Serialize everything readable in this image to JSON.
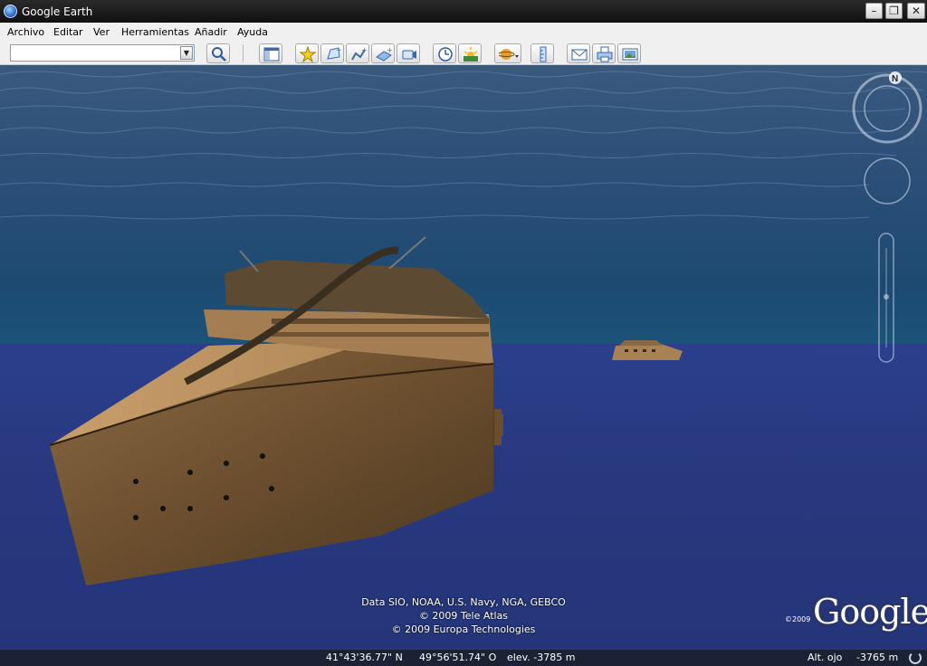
{
  "window": {
    "title": "Google Earth",
    "buttons": {
      "minimize": "–",
      "maximize": "❐",
      "close": "✕"
    }
  },
  "menu": [
    "Archivo",
    "Editar",
    "Ver",
    "Herramientas",
    "Añadir",
    "Ayuda"
  ],
  "search": {
    "value": "",
    "placeholder": ""
  },
  "toolbar": {
    "icons": [
      "search-icon",
      "sidebar-toggle-icon",
      "placemark-icon",
      "polygon-icon",
      "path-icon",
      "image-overlay-icon",
      "record-tour-icon",
      "historical-imagery-icon",
      "sunlight-icon",
      "planets-icon",
      "ruler-icon",
      "email-icon",
      "print-icon",
      "save-image-icon"
    ]
  },
  "view": {
    "attribution": [
      "Data SIO, NOAA, U.S. Navy, NGA, GEBCO",
      "© 2009 Tele Atlas",
      "© 2009 Europa Technologies"
    ],
    "logo": "Google",
    "logo_year": "©2009",
    "compass_north": "N"
  },
  "status": {
    "latitude": "41°43'36.77\" N",
    "longitude": "49°56'51.74\" O",
    "elevation": "elev. -3785 m",
    "eye_alt_label": "Alt. ojo",
    "eye_alt_value": "-3765 m"
  }
}
